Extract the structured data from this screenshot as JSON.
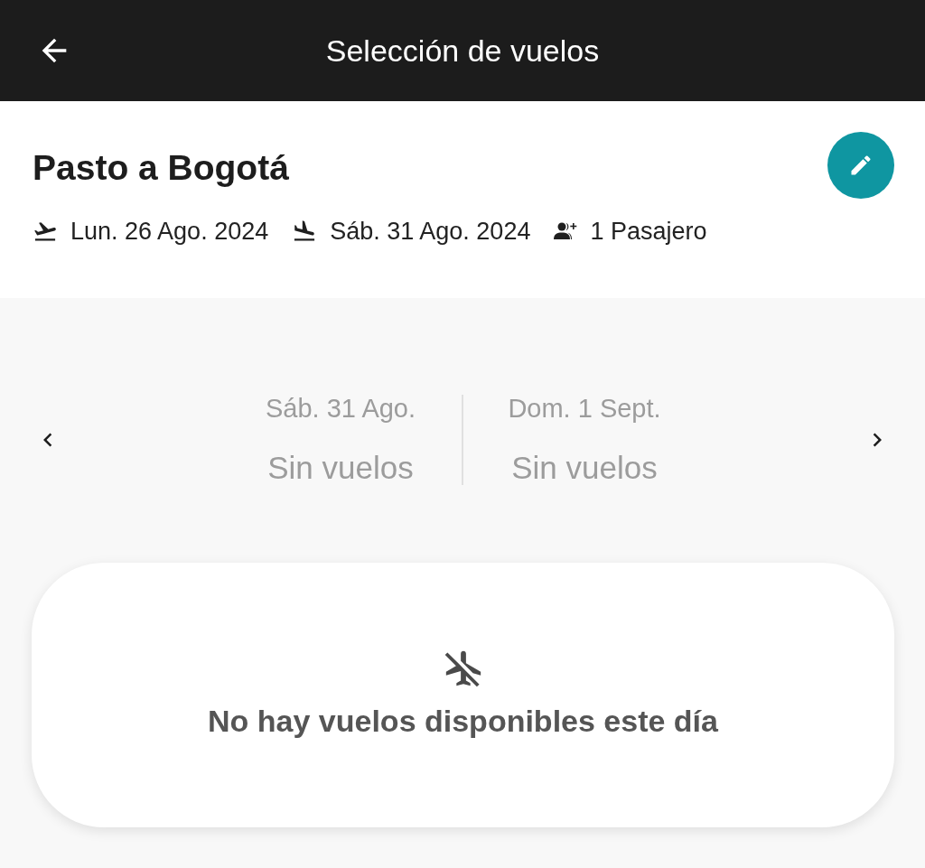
{
  "header": {
    "title": "Selección de vuelos"
  },
  "trip": {
    "route": "Pasto a Bogotá",
    "details": [
      {
        "kind": "departure",
        "text": "Lun. 26 Ago. 2024"
      },
      {
        "kind": "return",
        "text": "Sáb. 31 Ago. 2024"
      },
      {
        "kind": "passengers",
        "text": "1 Pasajero"
      }
    ]
  },
  "date_strip": {
    "days": [
      {
        "date": "Sáb. 31 Ago.",
        "status": "Sin vuelos"
      },
      {
        "date": "Dom. 1 Sept.",
        "status": "Sin vuelos"
      }
    ]
  },
  "empty_state": {
    "message": "No hay vuelos disponibles este día"
  }
}
